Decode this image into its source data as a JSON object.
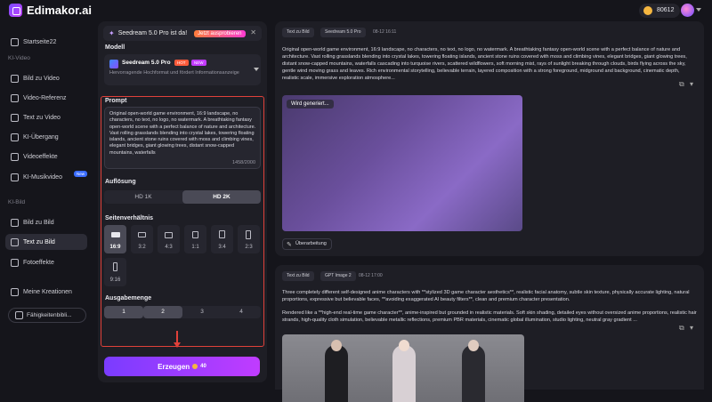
{
  "app": {
    "title": "Edimakor.ai",
    "credits": "80612"
  },
  "sidebar": {
    "items": [
      {
        "label": "Startseite22",
        "icon": "home-icon"
      },
      {
        "label": "Bild zu Video",
        "icon": "image-video-icon"
      },
      {
        "label": "Video-Referenz",
        "icon": "video-reference-icon"
      },
      {
        "label": "Text zu Video",
        "icon": "text-video-icon"
      },
      {
        "label": "KI-Übergang",
        "icon": "transition-icon"
      },
      {
        "label": "Videoeffekte",
        "icon": "effects-icon"
      },
      {
        "label": "KI-Musikvideo",
        "icon": "music-video-icon",
        "badge": "New"
      },
      {
        "label": "Bild zu Bild",
        "icon": "image-image-icon"
      },
      {
        "label": "Text zu Bild",
        "icon": "text-image-icon",
        "active": true
      },
      {
        "label": "Fotoeffekte",
        "icon": "photo-effects-icon"
      },
      {
        "label": "Meine Kreationen",
        "icon": "folder-icon"
      }
    ],
    "section_video": "KI-Video",
    "section_image": "KI-Bild",
    "skills_label": "Fähigkeitenbibli..."
  },
  "panel": {
    "promo_text": "Seedream 5.0 Pro ist da!",
    "promo_button": "Jetzt ausprobieren",
    "model_label": "Modell",
    "model_name": "Seedream 5.0 Pro",
    "model_tag_hot": "HOT",
    "model_tag_new": "NEW",
    "model_desc": "Hervorragende Hochformat und fördert Informationsanzeige",
    "prompt_label": "Prompt",
    "prompt_text": "Original open-world game environment, 16:9 landscape, no characters, no text, no logo, no watermark. A breathtaking fantasy open-world scene with a perfect balance of nature and architecture. Vast rolling grasslands blending into crystal lakes, towering floating islands, ancient stone ruins covered with moss and climbing vines, elegant bridges, giant glowing trees, distant snow-capped mountains, waterfalls",
    "prompt_count": "1458/2000",
    "resolution_label": "Auflösung",
    "resolutions": [
      "HD 1K",
      "HD 2K"
    ],
    "resolution_selected": 1,
    "ratio_label": "Seitenverhältnis",
    "ratios": [
      "16:9",
      "3:2",
      "4:3",
      "1:1",
      "3:4",
      "2:3",
      "9:16"
    ],
    "ratio_selected": 0,
    "count_label": "Ausgabemenge",
    "counts": [
      "1",
      "2",
      "3",
      "4"
    ],
    "generate_label": "Erzeugen",
    "generate_cost": "40"
  },
  "cards": [
    {
      "chip1": "Text zu Bild",
      "chip2": "Seedream 5.0 Pro",
      "time": "08-12 16:11",
      "text": "Original open-world game environment, 16:9 landscape, no characters, no text, no logo, no watermark. A breathtaking fantasy open-world scene with a perfect balance of nature and architecture. Vast rolling grasslands blending into crystal lakes, towering floating islands, ancient stone ruins covered with moss and climbing vines, elegant bridges, giant glowing trees, distant snow-capped mountains, waterfalls cascading into turquoise rivers, scattered wildflowers, soft morning mist, rays of sunlight breaking through clouds, birds flying across the sky, gentle wind moving grass and leaves. Rich environmental storytelling, believable terrain, layered composition with a strong foreground, midground and background, cinematic depth, realistic scale, immersive exploration atmosphere...",
      "status": "Wird generiert...",
      "edit_label": "Überarbeitung"
    },
    {
      "chip1": "Text zu Bild",
      "chip2": "GPT Image 2",
      "time": "08-12 17:00",
      "text": "Three completely different self-designed anime characters with **stylized 3D game character aesthetics**, realistic facial anatomy, subtle skin texture, physically accurate lighting, natural proportions, expressive but believable faces, **avoiding exaggerated AI beauty filters**, clean and premium character presentation.",
      "text2": "Rendered like a **high-end real-time game character**, anime-inspired but grounded in realistic materials. Soft skin shading, detailed eyes without oversized anime proportions, realistic hair strands, high-quality cloth simulation, believable metallic reflections, premium PBR materials, cinematic global illumination, studio lighting, neutral gray gradient ..."
    }
  ]
}
